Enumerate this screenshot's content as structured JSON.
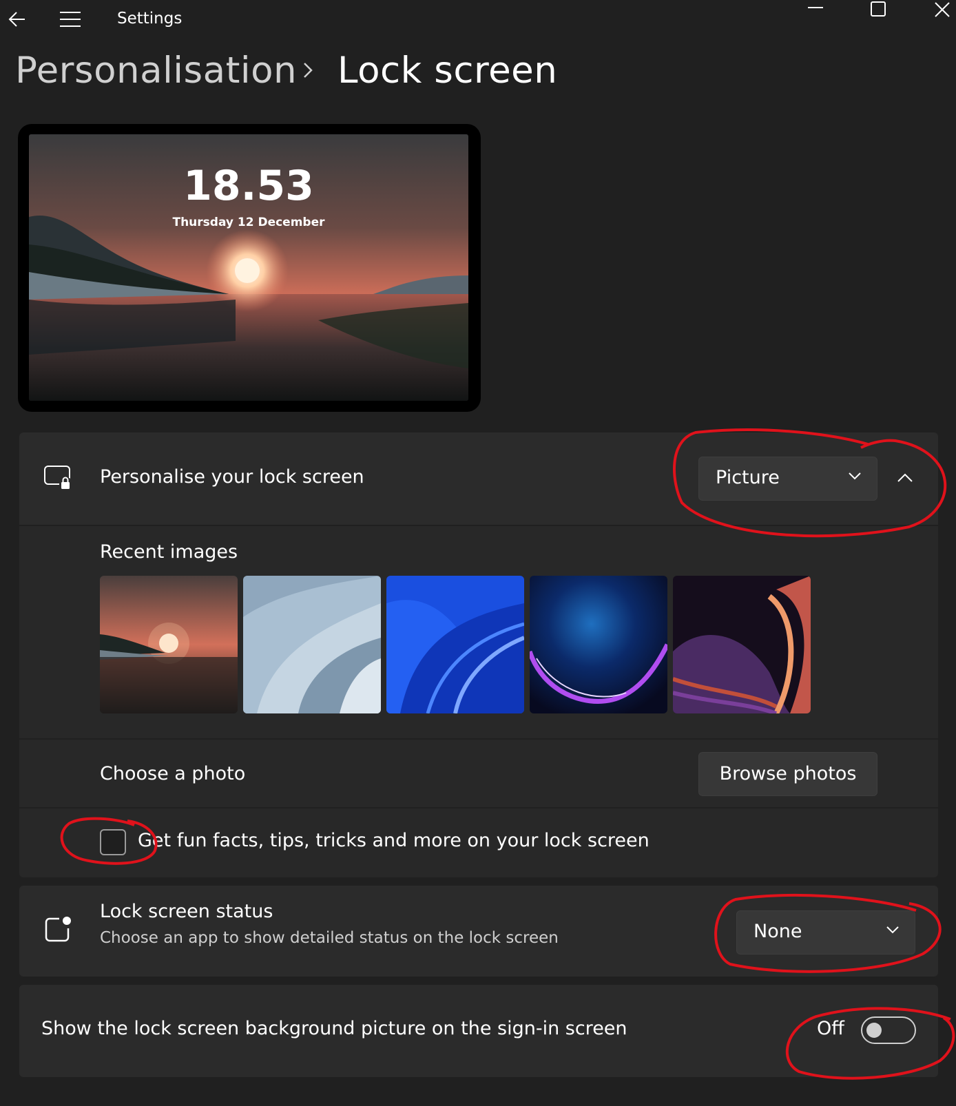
{
  "window": {
    "title": "Settings",
    "controls": [
      "minimize-icon",
      "maximize-icon",
      "close-icon"
    ]
  },
  "breadcrumb": {
    "parent": "Personalisation",
    "separator_icon": "chevron-right-icon",
    "current": "Lock screen"
  },
  "preview": {
    "time": "18.53",
    "date": "Thursday 12 December"
  },
  "personalise": {
    "icon": "lock-screen-icon",
    "label": "Personalise your lock screen",
    "dropdown_value": "Picture",
    "expanded": true
  },
  "recent_images": {
    "label": "Recent images",
    "items": [
      "sunset-lake",
      "grey-bloom",
      "blue-bloom",
      "glow-orb",
      "purple-ribbon"
    ]
  },
  "choose_photo": {
    "label": "Choose a photo",
    "button": "Browse photos"
  },
  "fun_facts": {
    "label": "Get fun facts, tips, tricks and more on your lock screen",
    "checked": false
  },
  "status": {
    "icon": "app-status-icon",
    "label": "Lock screen status",
    "description": "Choose an app to show detailed status on the lock screen",
    "dropdown_value": "None"
  },
  "signin": {
    "label": "Show the lock screen background picture on the sign-in screen",
    "toggle_text": "Off",
    "toggle_on": false
  },
  "colors": {
    "background": "#202020",
    "card": "#2b2b2b",
    "annotation": "#e0121b"
  }
}
